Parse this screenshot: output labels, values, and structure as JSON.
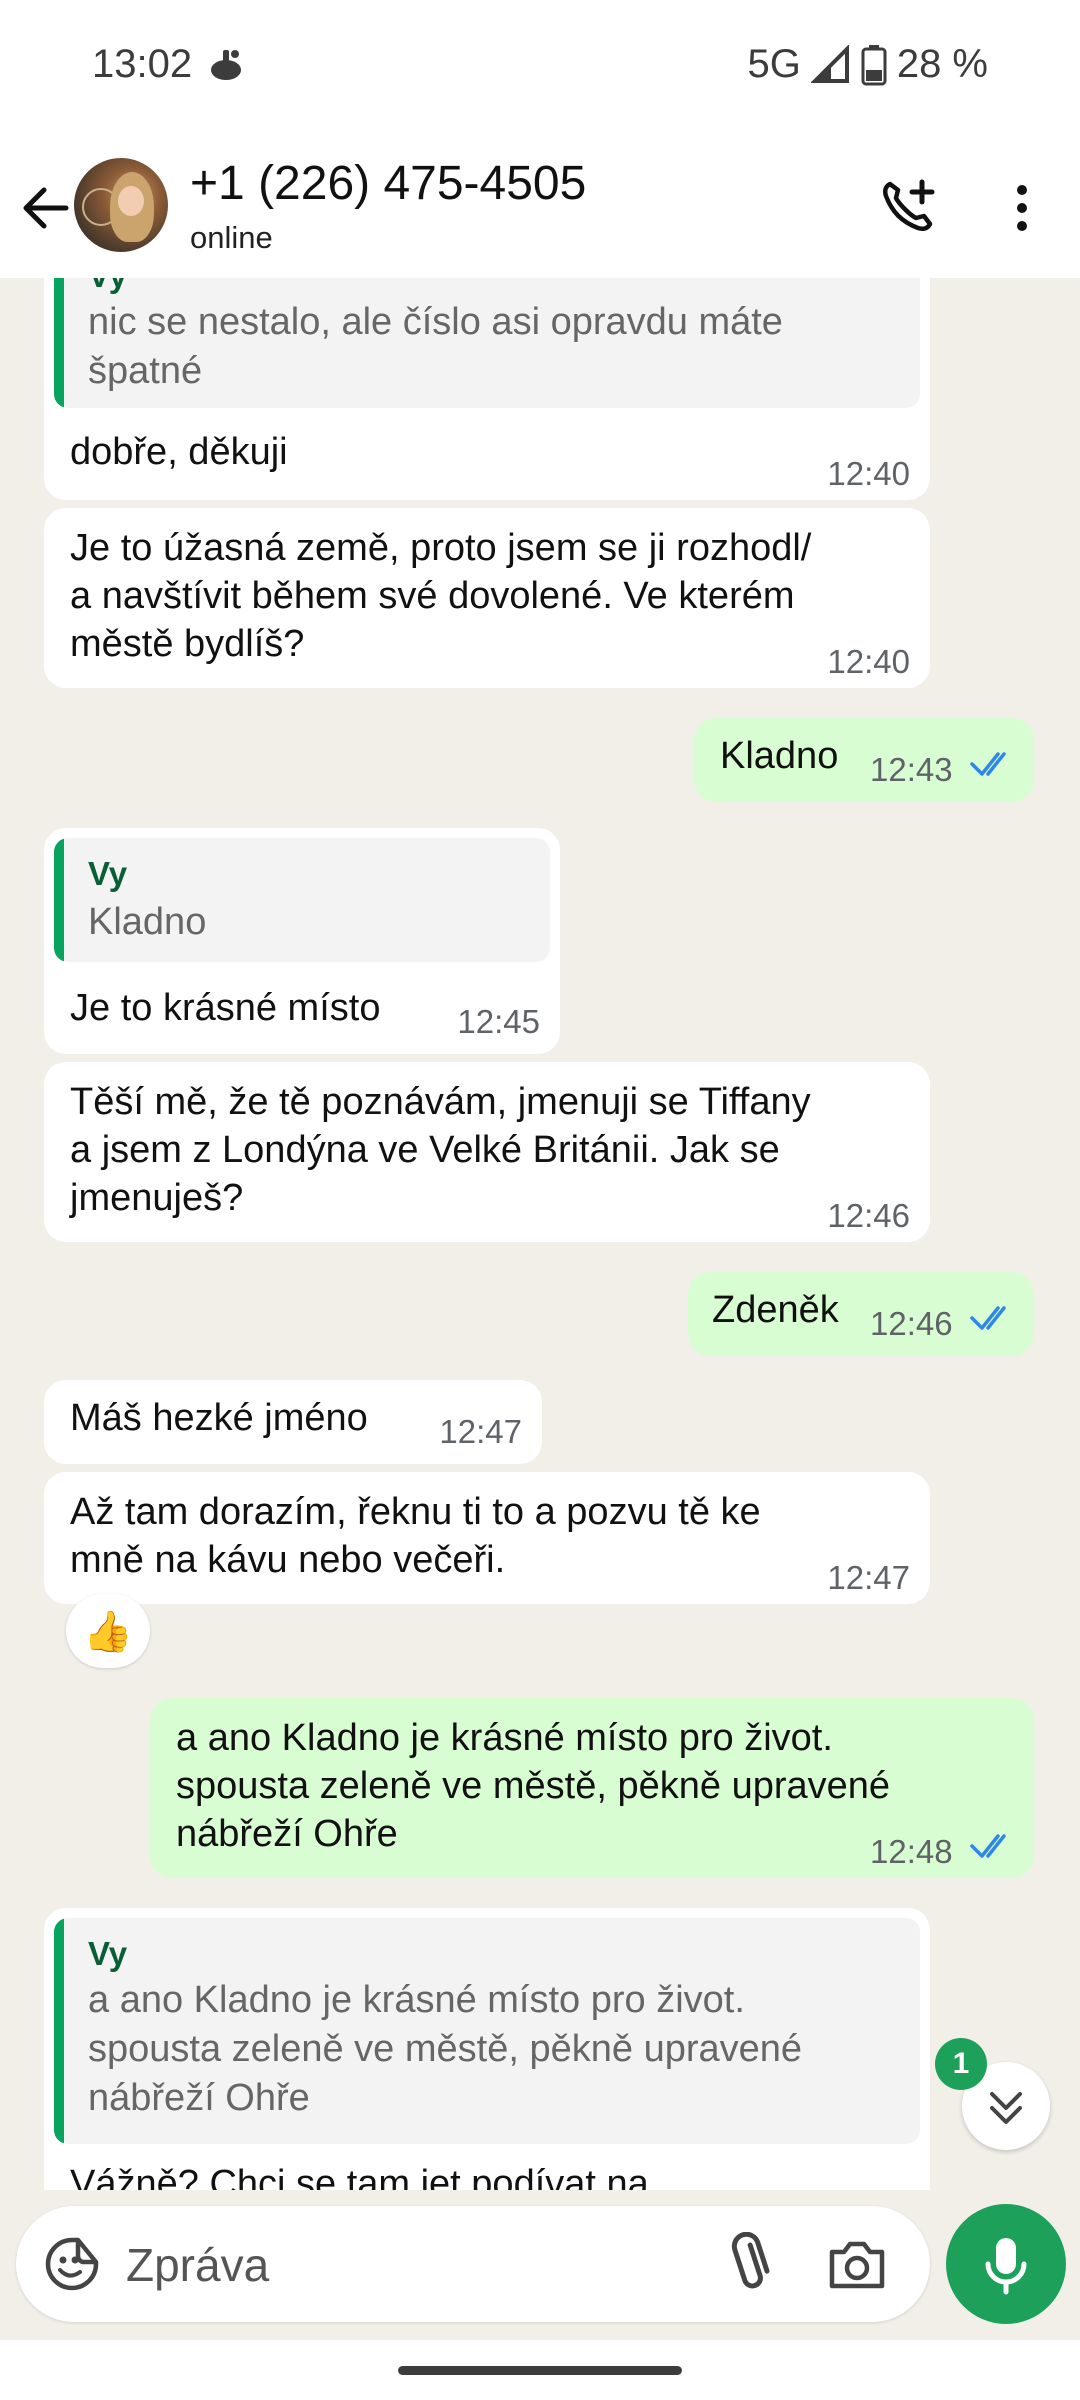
{
  "status_bar": {
    "time": "13:02",
    "network": "5G",
    "battery": "28 %"
  },
  "header": {
    "title": "+1 (226) 475-4505",
    "status": "online"
  },
  "messages": [
    {
      "quote_name": "Vy",
      "quote_text": [
        "nic se nestalo, ale číslo asi opravdu máte",
        "špatné"
      ],
      "text": [
        "dobře, děkuji"
      ],
      "time": "12:40"
    },
    {
      "text": [
        "Je to úžasná země, proto jsem se ji rozhodl/",
        "a navštívit během své dovolené. Ve kterém",
        "městě bydlíš?"
      ],
      "time": "12:40"
    },
    {
      "text": [
        "Kladno"
      ],
      "time": "12:43"
    },
    {
      "quote_name": "Vy",
      "quote_text": [
        "Kladno"
      ],
      "text": [
        "Je to krásné místo"
      ],
      "time": "12:45"
    },
    {
      "text": [
        "Těší mě, že tě poznávám, jmenuji se Tiffany",
        "a jsem z Londýna ve Velké Británii. Jak se",
        "jmenuješ?"
      ],
      "time": "12:46"
    },
    {
      "text": [
        "Zdeněk"
      ],
      "time": "12:46"
    },
    {
      "text": [
        "Máš hezké jméno"
      ],
      "time": "12:47"
    },
    {
      "text": [
        "Až tam dorazím, řeknu ti to a pozvu tě ke",
        "mně na kávu nebo večeři."
      ],
      "time": "12:47",
      "reaction": "👍"
    },
    {
      "text": [
        "a ano Kladno je krásné místo pro život.",
        "spousta zeleně ve městě, pěkně upravené",
        "nábřeží Ohře"
      ],
      "time": "12:48"
    },
    {
      "quote_name": "Vy",
      "quote_text": [
        "a ano Kladno je krásné místo pro život.",
        "spousta zeleně ve městě, pěkně upravené",
        "nábřeží Ohře"
      ],
      "text": [
        "Vážně? Chci se tam jet podívat na"
      ]
    }
  ],
  "scroll": {
    "unread_count": "1"
  },
  "composer": {
    "placeholder": "Zpráva"
  },
  "colors": {
    "accent": "#1da15a",
    "outgoing": "#d9fdd3",
    "incoming": "#ffffff",
    "chat_bg": "#f2efe9",
    "read_ticks": "#2f88e6"
  }
}
